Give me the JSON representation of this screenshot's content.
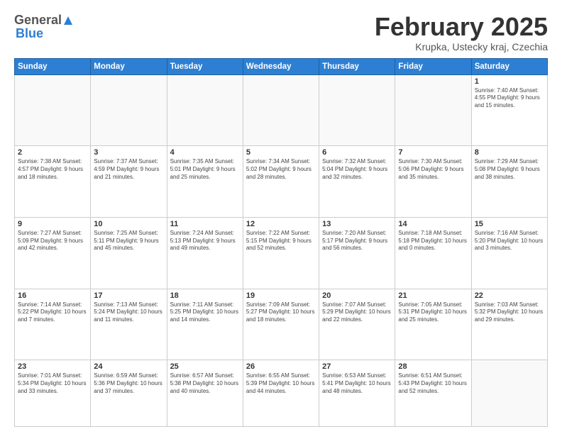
{
  "header": {
    "logo_general": "General",
    "logo_blue": "Blue",
    "month_title": "February 2025",
    "location": "Krupka, Ustecky kraj, Czechia"
  },
  "weekdays": [
    "Sunday",
    "Monday",
    "Tuesday",
    "Wednesday",
    "Thursday",
    "Friday",
    "Saturday"
  ],
  "weeks": [
    [
      {
        "day": "",
        "info": ""
      },
      {
        "day": "",
        "info": ""
      },
      {
        "day": "",
        "info": ""
      },
      {
        "day": "",
        "info": ""
      },
      {
        "day": "",
        "info": ""
      },
      {
        "day": "",
        "info": ""
      },
      {
        "day": "1",
        "info": "Sunrise: 7:40 AM\nSunset: 4:55 PM\nDaylight: 9 hours and 15 minutes."
      }
    ],
    [
      {
        "day": "2",
        "info": "Sunrise: 7:38 AM\nSunset: 4:57 PM\nDaylight: 9 hours and 18 minutes."
      },
      {
        "day": "3",
        "info": "Sunrise: 7:37 AM\nSunset: 4:59 PM\nDaylight: 9 hours and 21 minutes."
      },
      {
        "day": "4",
        "info": "Sunrise: 7:35 AM\nSunset: 5:01 PM\nDaylight: 9 hours and 25 minutes."
      },
      {
        "day": "5",
        "info": "Sunrise: 7:34 AM\nSunset: 5:02 PM\nDaylight: 9 hours and 28 minutes."
      },
      {
        "day": "6",
        "info": "Sunrise: 7:32 AM\nSunset: 5:04 PM\nDaylight: 9 hours and 32 minutes."
      },
      {
        "day": "7",
        "info": "Sunrise: 7:30 AM\nSunset: 5:06 PM\nDaylight: 9 hours and 35 minutes."
      },
      {
        "day": "8",
        "info": "Sunrise: 7:29 AM\nSunset: 5:08 PM\nDaylight: 9 hours and 38 minutes."
      }
    ],
    [
      {
        "day": "9",
        "info": "Sunrise: 7:27 AM\nSunset: 5:09 PM\nDaylight: 9 hours and 42 minutes."
      },
      {
        "day": "10",
        "info": "Sunrise: 7:25 AM\nSunset: 5:11 PM\nDaylight: 9 hours and 45 minutes."
      },
      {
        "day": "11",
        "info": "Sunrise: 7:24 AM\nSunset: 5:13 PM\nDaylight: 9 hours and 49 minutes."
      },
      {
        "day": "12",
        "info": "Sunrise: 7:22 AM\nSunset: 5:15 PM\nDaylight: 9 hours and 52 minutes."
      },
      {
        "day": "13",
        "info": "Sunrise: 7:20 AM\nSunset: 5:17 PM\nDaylight: 9 hours and 56 minutes."
      },
      {
        "day": "14",
        "info": "Sunrise: 7:18 AM\nSunset: 5:18 PM\nDaylight: 10 hours and 0 minutes."
      },
      {
        "day": "15",
        "info": "Sunrise: 7:16 AM\nSunset: 5:20 PM\nDaylight: 10 hours and 3 minutes."
      }
    ],
    [
      {
        "day": "16",
        "info": "Sunrise: 7:14 AM\nSunset: 5:22 PM\nDaylight: 10 hours and 7 minutes."
      },
      {
        "day": "17",
        "info": "Sunrise: 7:13 AM\nSunset: 5:24 PM\nDaylight: 10 hours and 11 minutes."
      },
      {
        "day": "18",
        "info": "Sunrise: 7:11 AM\nSunset: 5:25 PM\nDaylight: 10 hours and 14 minutes."
      },
      {
        "day": "19",
        "info": "Sunrise: 7:09 AM\nSunset: 5:27 PM\nDaylight: 10 hours and 18 minutes."
      },
      {
        "day": "20",
        "info": "Sunrise: 7:07 AM\nSunset: 5:29 PM\nDaylight: 10 hours and 22 minutes."
      },
      {
        "day": "21",
        "info": "Sunrise: 7:05 AM\nSunset: 5:31 PM\nDaylight: 10 hours and 25 minutes."
      },
      {
        "day": "22",
        "info": "Sunrise: 7:03 AM\nSunset: 5:32 PM\nDaylight: 10 hours and 29 minutes."
      }
    ],
    [
      {
        "day": "23",
        "info": "Sunrise: 7:01 AM\nSunset: 5:34 PM\nDaylight: 10 hours and 33 minutes."
      },
      {
        "day": "24",
        "info": "Sunrise: 6:59 AM\nSunset: 5:36 PM\nDaylight: 10 hours and 37 minutes."
      },
      {
        "day": "25",
        "info": "Sunrise: 6:57 AM\nSunset: 5:38 PM\nDaylight: 10 hours and 40 minutes."
      },
      {
        "day": "26",
        "info": "Sunrise: 6:55 AM\nSunset: 5:39 PM\nDaylight: 10 hours and 44 minutes."
      },
      {
        "day": "27",
        "info": "Sunrise: 6:53 AM\nSunset: 5:41 PM\nDaylight: 10 hours and 48 minutes."
      },
      {
        "day": "28",
        "info": "Sunrise: 6:51 AM\nSunset: 5:43 PM\nDaylight: 10 hours and 52 minutes."
      },
      {
        "day": "",
        "info": ""
      }
    ]
  ]
}
